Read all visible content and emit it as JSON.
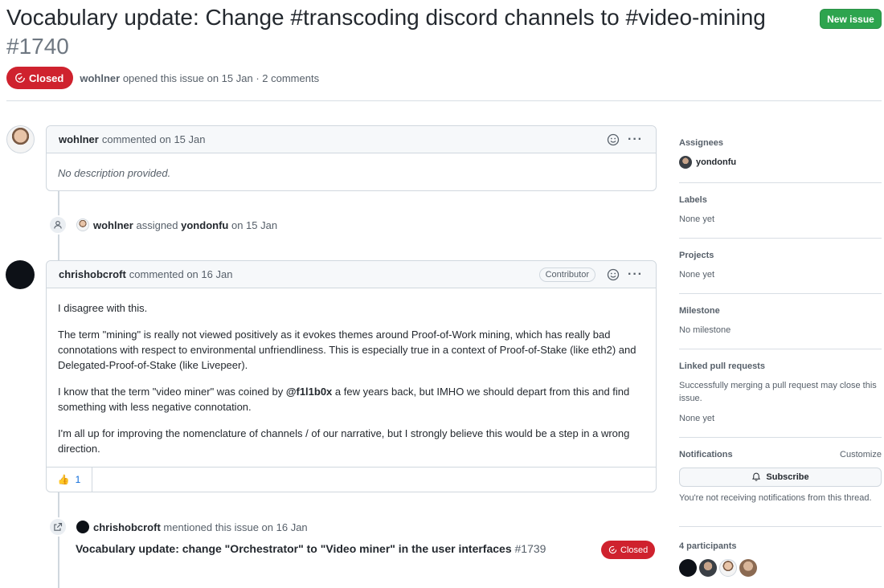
{
  "issue": {
    "title": "Vocabulary update: Change #transcoding discord channels to #video-mining",
    "number": "#1740",
    "state": "Closed",
    "author": "wohlner",
    "meta": "opened this issue on 15 Jan · 2 comments"
  },
  "header": {
    "new_issue_label": "New issue"
  },
  "comments": [
    {
      "author": "wohlner",
      "meta": "commented on 15 Jan",
      "body": "No description provided."
    },
    {
      "author": "chrishobcroft",
      "meta": "commented on 16 Jan",
      "badge": "Contributor",
      "paragraphs": [
        "I disagree with this.",
        "The term \"mining\" is really not viewed positively as it evokes themes around Proof-of-Work mining, which has really bad connotations with respect to environmental unfriendliness. This is especially true in a context of Proof-of-Stake (like eth2) and Delegated-Proof-of-Stake (like Livepeer).",
        "I'm all up for improving the nomenclature of channels / of our narrative, but I strongly believe this would be a step in a wrong direction."
      ],
      "p3_pre": "I know that the term \"video miner\" was coined by ",
      "p3_mention": "@f1l1b0x",
      "p3_post": " a few years back, but IMHO we should depart from this and find something with less negative connotation.",
      "reaction_emoji": "👍",
      "reaction_count": "1"
    }
  ],
  "events": {
    "assign": {
      "actor": "wohlner",
      "verb": "assigned",
      "target": "yondonfu",
      "when": "on 15 Jan"
    },
    "mention": {
      "actor": "chrishobcroft",
      "text": "mentioned this issue on 16 Jan",
      "ref_title": "Vocabulary update: change \"Orchestrator\" to \"Video miner\" in the user interfaces",
      "ref_number": "#1739",
      "ref_state": "Closed"
    }
  },
  "sidebar": {
    "assignees": {
      "heading": "Assignees",
      "value": "yondonfu"
    },
    "labels": {
      "heading": "Labels",
      "value": "None yet"
    },
    "projects": {
      "heading": "Projects",
      "value": "None yet"
    },
    "milestone": {
      "heading": "Milestone",
      "value": "No milestone"
    },
    "linked_prs": {
      "heading": "Linked pull requests",
      "note": "Successfully merging a pull request may close this issue.",
      "value": "None yet"
    },
    "notifications": {
      "heading": "Notifications",
      "customize": "Customize",
      "subscribe": "Subscribe",
      "note": "You're not receiving notifications from this thread."
    },
    "participants": {
      "heading": "4 participants"
    }
  },
  "colors": {
    "closed": "#cf222e",
    "primary": "#2da44e",
    "link": "#0969da"
  }
}
